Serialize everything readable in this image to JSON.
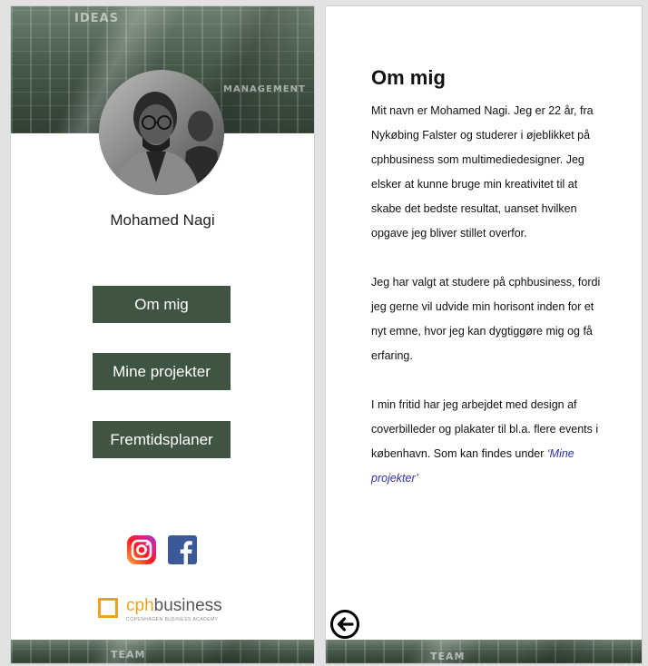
{
  "left_screen": {
    "banner_top_words": [
      "IDEAS",
      "MANAGEMENT"
    ],
    "banner_bottom_word": "TEAM",
    "profile_name": "Mohamed Nagi",
    "nav": [
      {
        "label": "Om mig"
      },
      {
        "label": "Mine projekter"
      },
      {
        "label": "Fremtidsplaner"
      }
    ],
    "social": [
      {
        "icon": "instagram-icon",
        "color": "#d6249f"
      },
      {
        "icon": "facebook-icon",
        "color": "#3b5998"
      }
    ],
    "logo": {
      "part1": "cph",
      "part2": "business",
      "tagline": "COPENHAGEN BUSINESS ACADEMY",
      "accent": "#f0a21f"
    }
  },
  "right_screen": {
    "title": "Om mig",
    "paragraphs": [
      "Mit navn er Mohamed Nagi. Jeg er 22 år, fra Nykøbing Falster og studerer i øjeblikket på cphbusiness som multimediedesigner. Jeg elsker at kunne bruge min kreativitet til at skabe det bedste resultat, uanset hvilken opgave jeg bliver stillet overfor.",
      "Jeg har valgt at studere på cphbusiness, fordi jeg gerne vil udvide min horisont inden for et nyt emne, hvor jeg kan dygtiggøre mig og få erfaring."
    ],
    "paragraph3_text": "I min fritid har jeg arbejdet med design af coverbilleder og plakater til bl.a. flere events i københavn. Som kan findes under",
    "paragraph3_link": "‘Mine projekter’",
    "back_icon": "back-arrow-icon",
    "banner_bottom_word": "TEAM"
  },
  "colors": {
    "button_green": "#3f5542",
    "link_blue": "#2f2fa8"
  }
}
